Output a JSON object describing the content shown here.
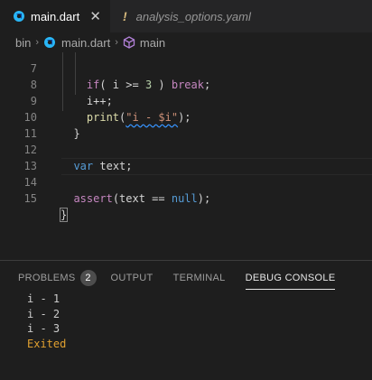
{
  "tabs": [
    {
      "label": "main.dart",
      "active": true,
      "icon": "dart-icon",
      "close": "✕"
    },
    {
      "label": "analysis_options.yaml",
      "active": false,
      "icon": "warning-icon",
      "marker": "!"
    }
  ],
  "breadcrumb": {
    "items": [
      "bin",
      "main.dart",
      "main"
    ],
    "separator": "›"
  },
  "editor": {
    "lines": [
      {
        "num": "7",
        "text": "    if( i >= 3 ) break;"
      },
      {
        "num": "8",
        "text": "    i++;"
      },
      {
        "num": "9",
        "text": "    print(\"i - $i\");"
      },
      {
        "num": "10",
        "text": "  }"
      },
      {
        "num": "11",
        "text": ""
      },
      {
        "num": "12",
        "text": "  var text;"
      },
      {
        "num": "13",
        "text": ""
      },
      {
        "num": "14",
        "text": "  assert(text == null);"
      },
      {
        "num": "15",
        "text": "}"
      }
    ]
  },
  "panel": {
    "tabs": [
      {
        "label": "PROBLEMS",
        "badge": "2",
        "active": false
      },
      {
        "label": "OUTPUT",
        "active": false
      },
      {
        "label": "TERMINAL",
        "active": false
      },
      {
        "label": "DEBUG CONSOLE",
        "active": true
      }
    ],
    "console": [
      "i - 1",
      "i - 2",
      "i - 3"
    ],
    "exit_message": "Exited"
  },
  "colors": {
    "background": "#1e1e1e",
    "keyword": "#c586c0",
    "string": "#ce9178",
    "function": "#dcdcaa",
    "exited": "#e0a030"
  }
}
